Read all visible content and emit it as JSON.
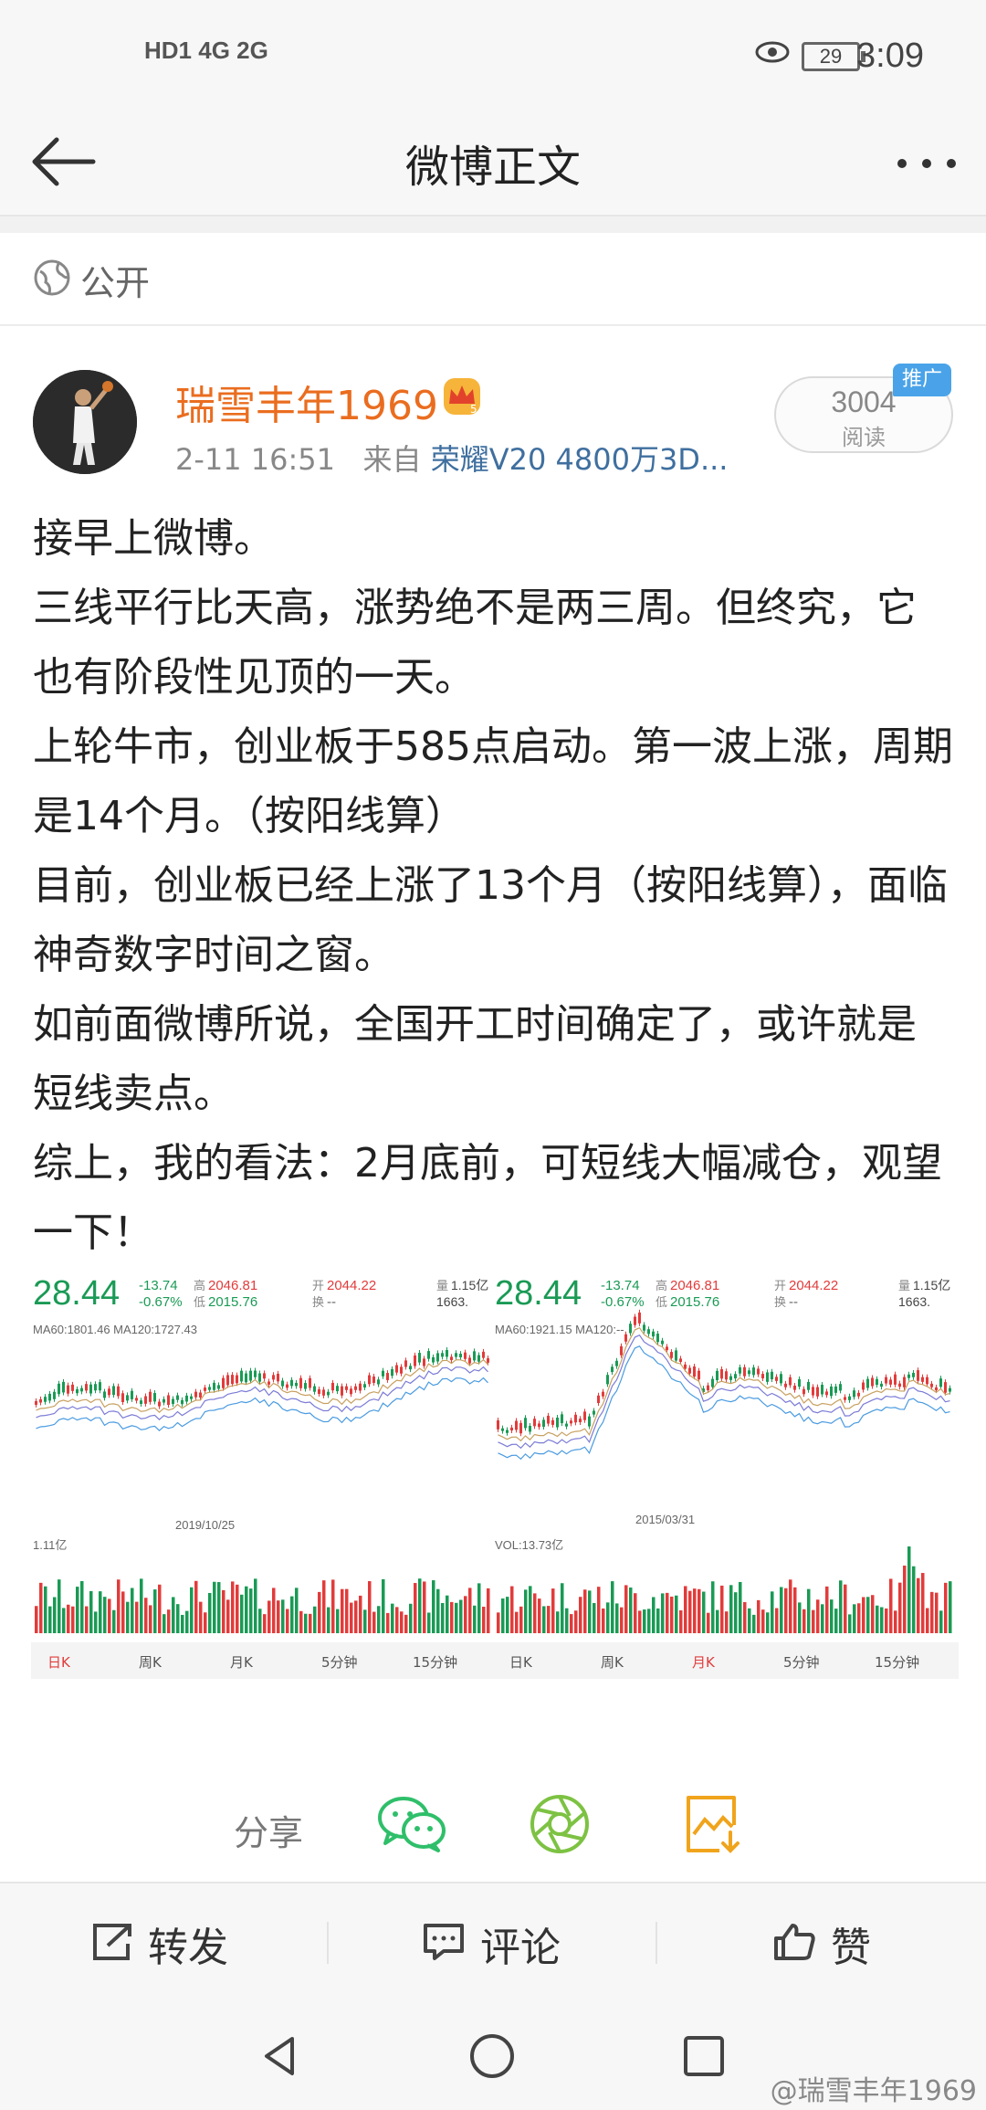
{
  "status_bar": {
    "left": "HD1 4G 2G",
    "battery": "29",
    "time": "3:09"
  },
  "nav": {
    "title": "微博正文"
  },
  "visibility": "公开",
  "post": {
    "author": "瑞雪丰年1969",
    "time": "2-11 16:51",
    "source_prefix": "来自",
    "source": "荣耀V20 4800万3D...",
    "reads": "3004",
    "reads_label": "阅读",
    "promo": "推广",
    "paragraphs": [
      "接早上微博。",
      "三线平行比天高，涨势绝不是两三周。但终究，它也有阶段性见顶的一天。",
      "上轮牛市，创业板于585点启动。第一波上涨，周期是14个月。（按阳线算）",
      "目前，创业板已经上涨了13个月（按阳线算），面临神奇数字时间之窗。",
      "如前面微博所说，全国开工时间确定了，或许就是短线卖点。",
      "综上，我的看法：2月底前，可短线大幅减仓，观望一下！"
    ]
  },
  "charts": [
    {
      "price": "28.44",
      "chg": "-13.74",
      "chg_pct": "-0.67%",
      "high_label": "高",
      "high": "2046.81",
      "low_label": "低",
      "low": "2015.76",
      "open_label": "开",
      "open": "2044.22",
      "turn_label": "换",
      "turn": "--",
      "vol_label": "量",
      "vol": "1.15亿",
      "amt": "1663.",
      "ma_text": "MA60:1801.46 MA120:1727.43",
      "date": "2019/10/25",
      "vol_text": "1.11亿",
      "tabs": [
        "日K",
        "周K",
        "月K",
        "5分钟",
        "15分钟"
      ],
      "active_tab": 0
    },
    {
      "price": "28.44",
      "chg": "-13.74",
      "chg_pct": "-0.67%",
      "high_label": "高",
      "high": "2046.81",
      "low_label": "低",
      "low": "2015.76",
      "open_label": "开",
      "open": "2044.22",
      "turn_label": "换",
      "turn": "--",
      "vol_label": "量",
      "vol": "1.15亿",
      "amt": "1663.",
      "ma_text": "MA60:1921.15 MA120:--",
      "date": "2015/03/31",
      "vol_text": "VOL:13.73亿",
      "tabs": [
        "日K",
        "周K",
        "月K",
        "5分钟",
        "15分钟"
      ],
      "active_tab": 2
    }
  ],
  "share": {
    "label": "分享"
  },
  "actions": {
    "repost": "转发",
    "comment": "评论",
    "like": "赞"
  },
  "watermark": "@瑞雪丰年1969"
}
